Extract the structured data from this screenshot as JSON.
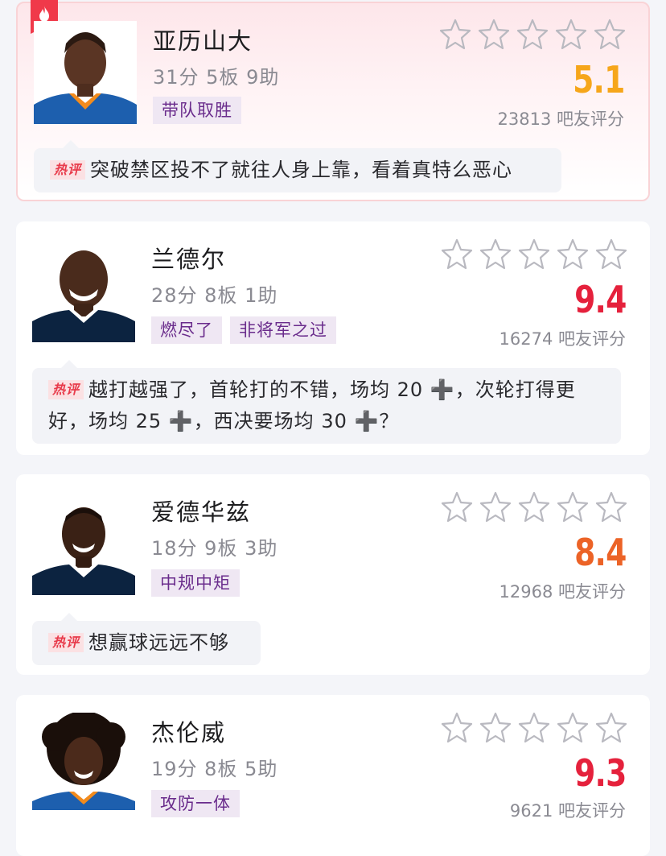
{
  "colors": {
    "score_gold": "#f6a61a",
    "score_red": "#e5213c",
    "score_orange": "#ec6327",
    "tag_bg": "#efe7f3",
    "tag_text": "#6a2c8c",
    "hot_badge": "#e83a4a"
  },
  "icons": {
    "star": "star-outline-icon",
    "fire": "fire-icon",
    "plus": "plus-icon"
  },
  "players": [
    {
      "name": "亚历山大",
      "stats": "31分 5板 9助",
      "tags": [
        "带队取胜"
      ],
      "score": "5.1",
      "score_color": "gold",
      "rating_count": "23813 吧友评分",
      "hot_label": "热评",
      "comment": "突破禁区投不了就往人身上靠，看着真特么恶心"
    },
    {
      "name": "兰德尔",
      "stats": "28分 8板 1助",
      "tags": [
        "燃尽了",
        "非将军之过"
      ],
      "score": "9.4",
      "score_color": "red",
      "rating_count": "16274 吧友评分",
      "hot_label": "热评",
      "comment_parts": [
        "越打越强了，首轮打的不错，场均 20 ",
        "➕",
        "，次轮打得更好，场均 25 ",
        "➕",
        "，西决要场均 30 ",
        "➕",
        "？"
      ]
    },
    {
      "name": "爱德华兹",
      "stats": "18分 9板 3助",
      "tags": [
        "中规中矩"
      ],
      "score": "8.4",
      "score_color": "orange",
      "rating_count": "12968 吧友评分",
      "hot_label": "热评",
      "comment": "想赢球远远不够"
    },
    {
      "name": "杰伦威",
      "stats": "19分 8板 5助",
      "tags": [
        "攻防一体"
      ],
      "score": "9.3",
      "score_color": "red",
      "rating_count": "9621 吧友评分"
    }
  ]
}
